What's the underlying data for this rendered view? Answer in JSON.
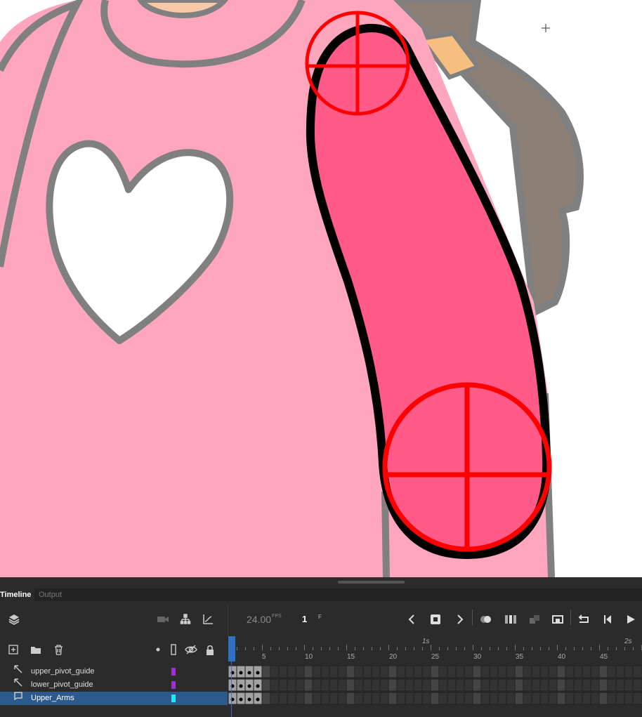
{
  "tabs": {
    "timeline": "Timeline",
    "output": "Output"
  },
  "toolbar": {
    "fps_value": "24.00",
    "fps_unit": "FPS",
    "current_frame": "1",
    "frame_unit": "F"
  },
  "ruler": {
    "ticks": [
      "5",
      "10",
      "15",
      "20",
      "25",
      "30",
      "35",
      "40",
      "45"
    ],
    "seconds": [
      "1s",
      "2s"
    ]
  },
  "layers": [
    {
      "name": "upper_pivot_guide",
      "color": "#9b30d0",
      "type": "guide-icon"
    },
    {
      "name": "lower_pivot_guide",
      "color": "#9b30d0",
      "type": "guide-icon"
    },
    {
      "name": "Upper_Arms",
      "color": "#20e8f0",
      "type": "layer-icon",
      "selected": true
    }
  ],
  "colors": {
    "shirt": "#ffa6bf",
    "arm": "#ff5a88",
    "outline_gray": "#808080",
    "hair": "#8c8076",
    "pivot_red": "#ff0000",
    "panel_bg": "#2b2b2b",
    "selected_layer": "#2c5a8c"
  }
}
